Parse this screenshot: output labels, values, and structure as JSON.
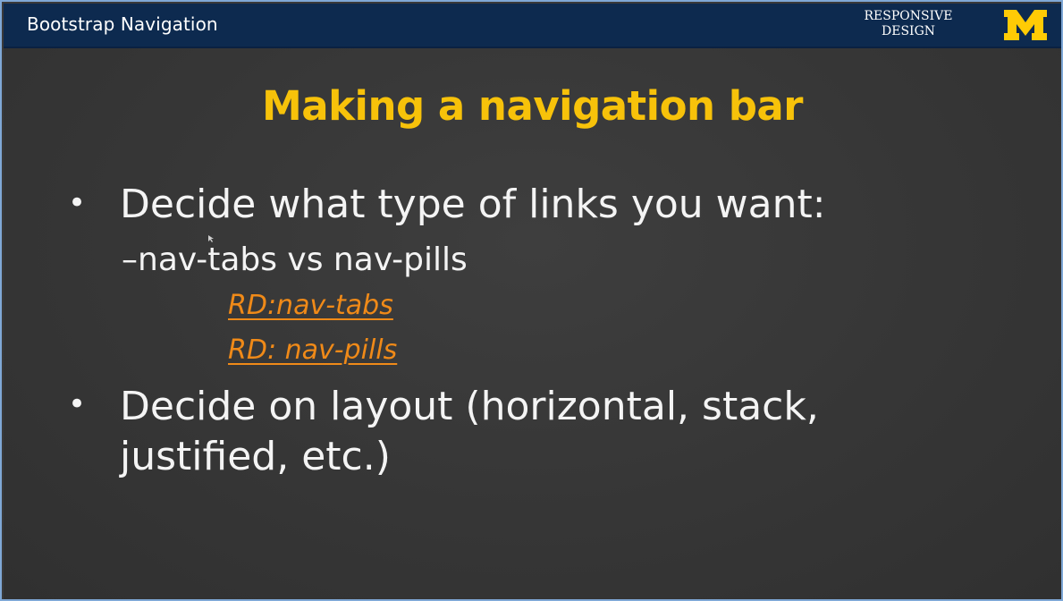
{
  "header": {
    "title": "Bootstrap Navigation",
    "brand_line1": "RESPONSIVE",
    "brand_line2": "DESIGN",
    "logo_icon": "block-m-logo",
    "logo_color": "#FFCB05"
  },
  "slide": {
    "title": "Making a navigation bar",
    "bullets": [
      {
        "text": "Decide what type of links you want:",
        "sub": "nav-tabs vs nav-pills",
        "links": [
          "RD:nav-tabs",
          "RD: nav-pills"
        ]
      },
      {
        "line1": "Decide on layout (horizontal, stack,",
        "line2": "justified, etc.)"
      }
    ]
  },
  "colors": {
    "header_bg": "#0d2a4f",
    "title": "#f7c20a",
    "link": "#f08a18",
    "text": "#f4f4f4"
  }
}
